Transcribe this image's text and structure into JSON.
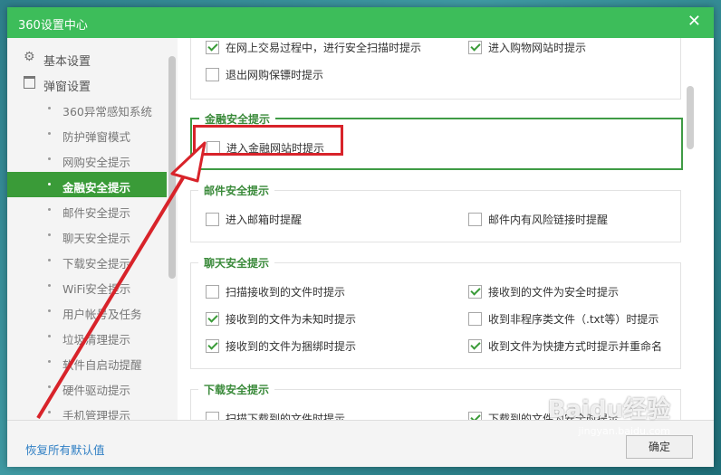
{
  "window": {
    "title": "360设置中心",
    "close_glyph": "✕"
  },
  "sidebar": {
    "sections": [
      {
        "label": "基本设置",
        "icon": "gear-icon"
      },
      {
        "label": "弹窗设置",
        "icon": "window-icon"
      }
    ],
    "items": [
      {
        "label": "360异常感知系统"
      },
      {
        "label": "防护弹窗模式"
      },
      {
        "label": "网购安全提示"
      },
      {
        "label": "金融安全提示",
        "active": true
      },
      {
        "label": "邮件安全提示"
      },
      {
        "label": "聊天安全提示"
      },
      {
        "label": "下载安全提示"
      },
      {
        "label": "WiFi安全提示"
      },
      {
        "label": "用户帐号及任务"
      },
      {
        "label": "垃圾清理提示"
      },
      {
        "label": "软件自启动提醒"
      },
      {
        "label": "硬件驱动提示"
      },
      {
        "label": "手机管理提示"
      }
    ]
  },
  "footer": {
    "restore": "恢复所有默认值",
    "ok": "确定"
  },
  "groups": {
    "shopping": {
      "options": [
        {
          "label": "在网上交易过程中，进行安全扫描时提示",
          "checked": true
        },
        {
          "label": "进入购物网站时提示",
          "checked": true
        },
        {
          "label": "退出网购保镖时提示",
          "checked": false
        }
      ]
    },
    "finance": {
      "title": "金融安全提示",
      "options": [
        {
          "label": "进入金融网站时提示",
          "checked": false
        }
      ]
    },
    "mail": {
      "title": "邮件安全提示",
      "options": [
        {
          "label": "进入邮箱时提醒",
          "checked": false
        },
        {
          "label": "邮件内有风险链接时提醒",
          "checked": false
        }
      ]
    },
    "chat": {
      "title": "聊天安全提示",
      "options": [
        {
          "label": "扫描接收到的文件时提示",
          "checked": false
        },
        {
          "label": "接收到的文件为安全时提示",
          "checked": true
        },
        {
          "label": "接收到的文件为未知时提示",
          "checked": true
        },
        {
          "label": "收到非程序类文件（.txt等）时提示",
          "checked": false
        },
        {
          "label": "接收到的文件为捆绑时提示",
          "checked": true
        },
        {
          "label": "收到文件为快捷方式时提示并重命名",
          "checked": true
        }
      ]
    },
    "download": {
      "title": "下载安全提示",
      "options": [
        {
          "label": "扫描下载到的文件时提示",
          "checked": false
        },
        {
          "label": "下载到的文件为安全时提示",
          "checked": true
        }
      ]
    }
  },
  "watermark": {
    "text": "Baidu经验",
    "url": "jingyan.baidu.com"
  },
  "colors": {
    "accent": "#3dbd5a",
    "highlight": "#d8232a"
  }
}
